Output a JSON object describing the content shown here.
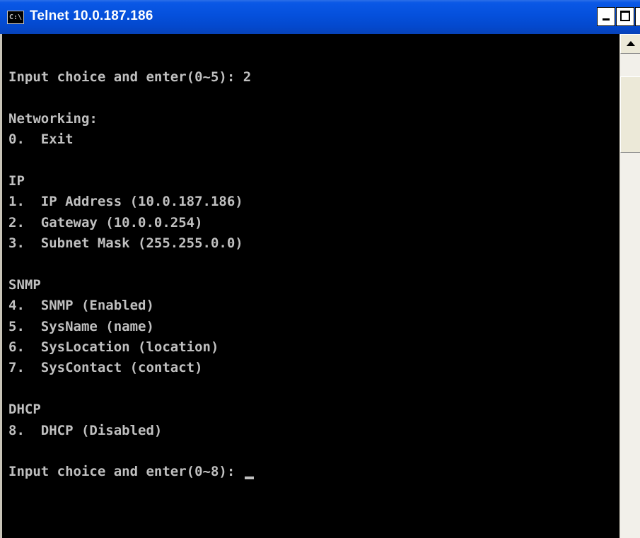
{
  "window": {
    "title": "Telnet 10.0.187.186",
    "sysicon_text": "C:\\",
    "close_glyph": "×"
  },
  "console": {
    "lines": [
      "",
      "Input choice and enter(0~5): 2",
      "",
      "Networking:",
      "0.  Exit",
      "",
      "IP",
      "1.  IP Address (10.0.187.186)",
      "2.  Gateway (10.0.0.254)",
      "3.  Subnet Mask (255.255.0.0)",
      "",
      "SNMP",
      "4.  SNMP (Enabled)",
      "5.  SysName (name)",
      "6.  SysLocation (location)",
      "7.  SysContact (contact)",
      "",
      "DHCP",
      "8.  DHCP (Disabled)",
      "",
      "Input choice and enter(0~8): "
    ]
  },
  "colors": {
    "titlebar": "#0550dc",
    "console_bg": "#000000",
    "console_fg": "#c0c0c0"
  }
}
